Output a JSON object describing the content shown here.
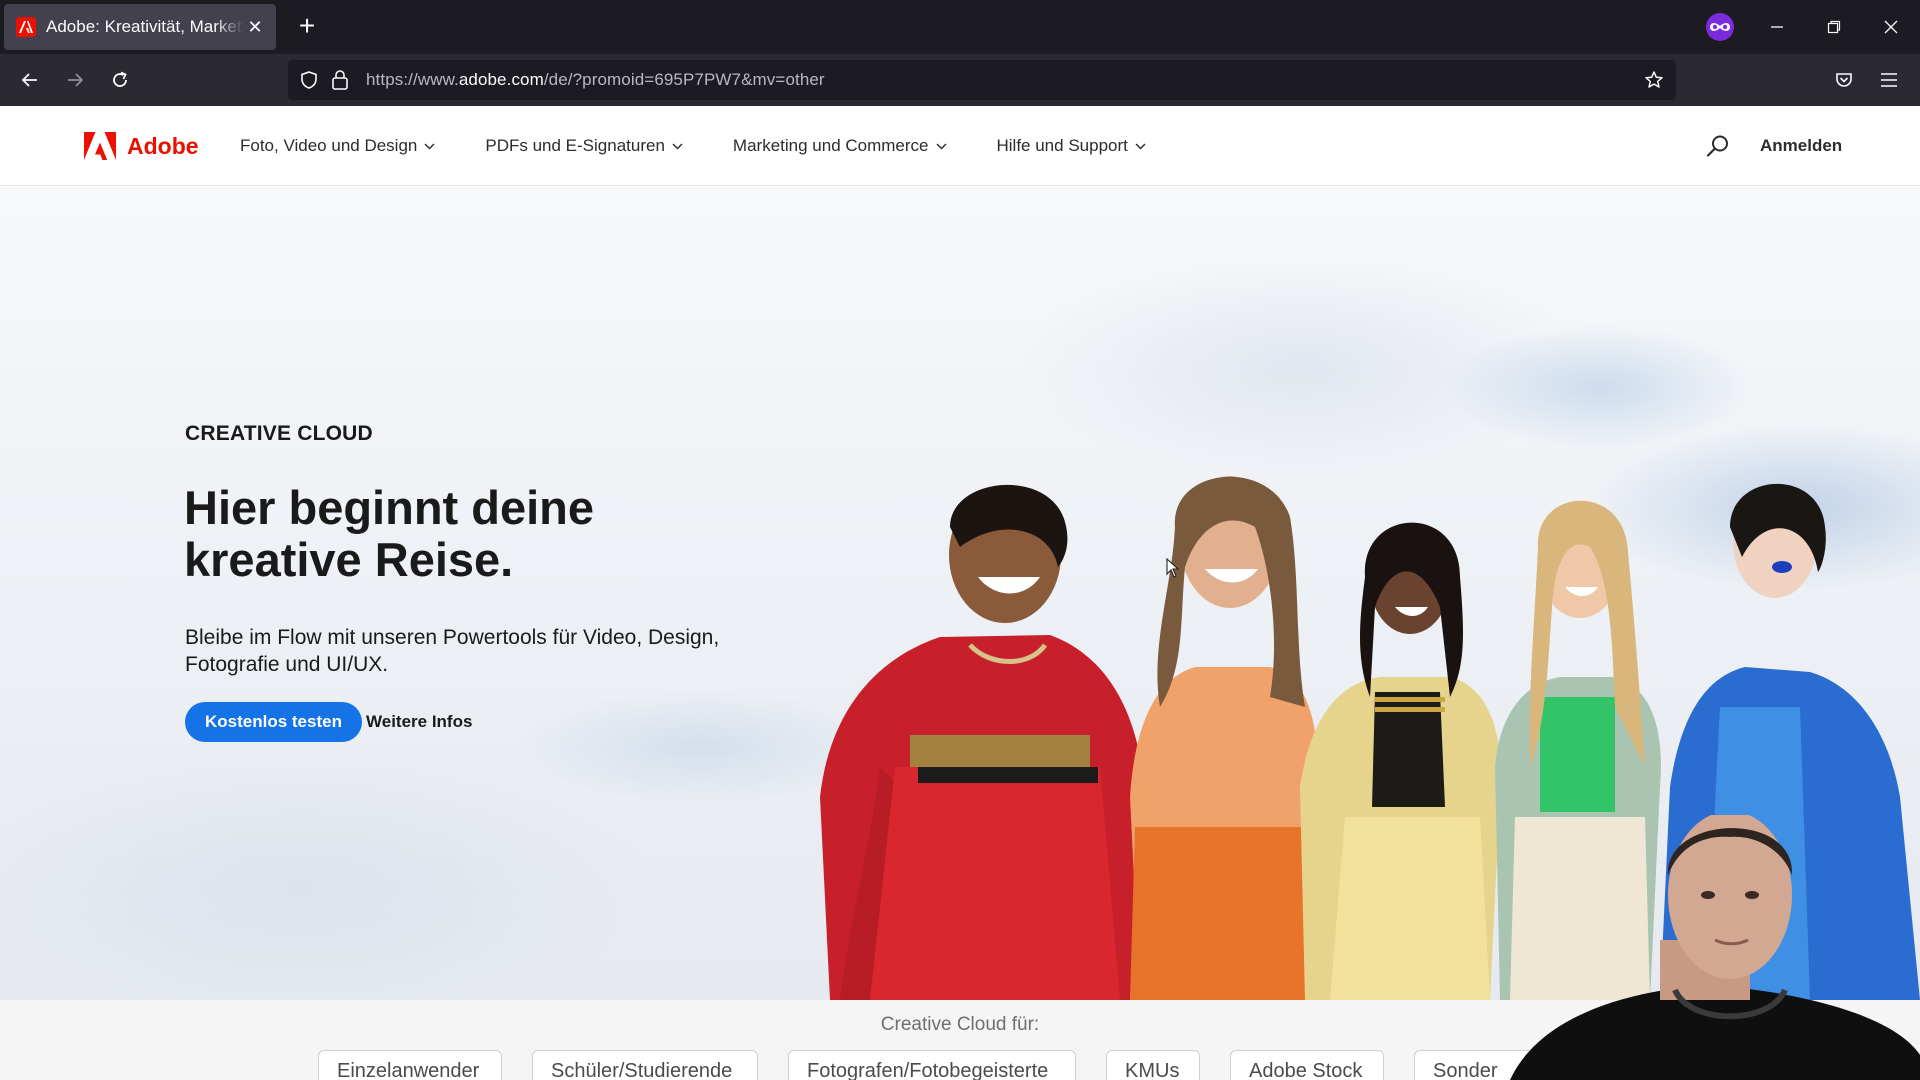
{
  "browser": {
    "tab_title": "Adobe: Kreativität, Marketing und Dokumentverwaltung",
    "url_prefix": "https://www.",
    "url_host": "adobe.com",
    "url_path": "/de/?promoid=695P7PW7&mv=other",
    "colors": {
      "titlebar": "#1c1b22",
      "toolbar": "#2b2a33",
      "private_badge": "#7a2cdc"
    }
  },
  "header": {
    "logo_text": "Adobe",
    "menu": [
      {
        "label": "Foto, Video und Design"
      },
      {
        "label": "PDFs und E-Signaturen"
      },
      {
        "label": "Marketing und Commerce"
      },
      {
        "label": "Hilfe und Support"
      }
    ],
    "sign_in": "Anmelden",
    "brand_color": "#eb1000"
  },
  "hero": {
    "eyebrow": "CREATIVE CLOUD",
    "headline": "Hier beginnt deine kreative Reise.",
    "subhead": "Bleibe im Flow mit unseren Powertools für Video, Design, Fotografie und UI/UX.",
    "primary_cta": "Kostenlos testen",
    "secondary_cta": "Weitere Infos",
    "cta_color": "#1473e6"
  },
  "audience": {
    "label": "Creative Cloud für:",
    "options": [
      {
        "label": "Einzelanwender"
      },
      {
        "label": "Schüler/Studierende"
      },
      {
        "label": "Fotografen/Fotobegeisterte"
      },
      {
        "label": "KMUs"
      },
      {
        "label": "Adobe Stock"
      },
      {
        "label": "Sonder"
      }
    ]
  }
}
